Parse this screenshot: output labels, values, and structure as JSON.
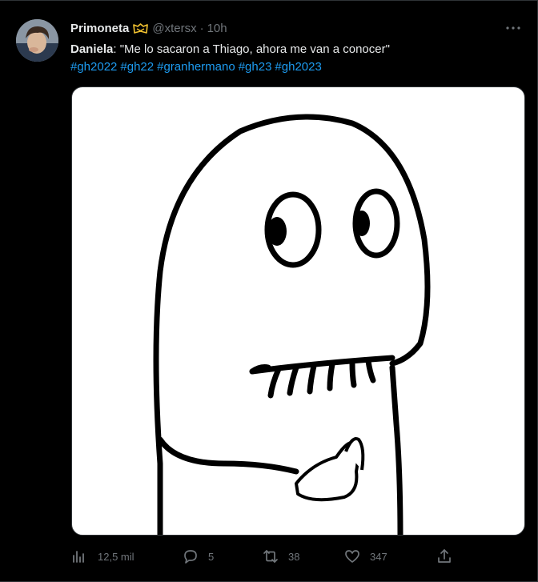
{
  "author": {
    "name": "Primoneta",
    "handle": "@xtersx",
    "time": "10h",
    "separator": "·"
  },
  "tweet": {
    "speaker": "Daniela",
    "quote": ": \"Me lo sacaron a Thiago, ahora me van a conocer\"",
    "hashtags": [
      "#gh2022",
      "#gh22",
      "#granhermano",
      "#gh23",
      "#gh2023"
    ]
  },
  "stats": {
    "views": "12,5 mil",
    "replies": "5",
    "retweets": "38",
    "likes": "347"
  },
  "colors": {
    "background": "#000000",
    "text": "#e7e9ea",
    "muted": "#71767b",
    "link": "#1d9bf0",
    "badge": "#f4c430"
  }
}
